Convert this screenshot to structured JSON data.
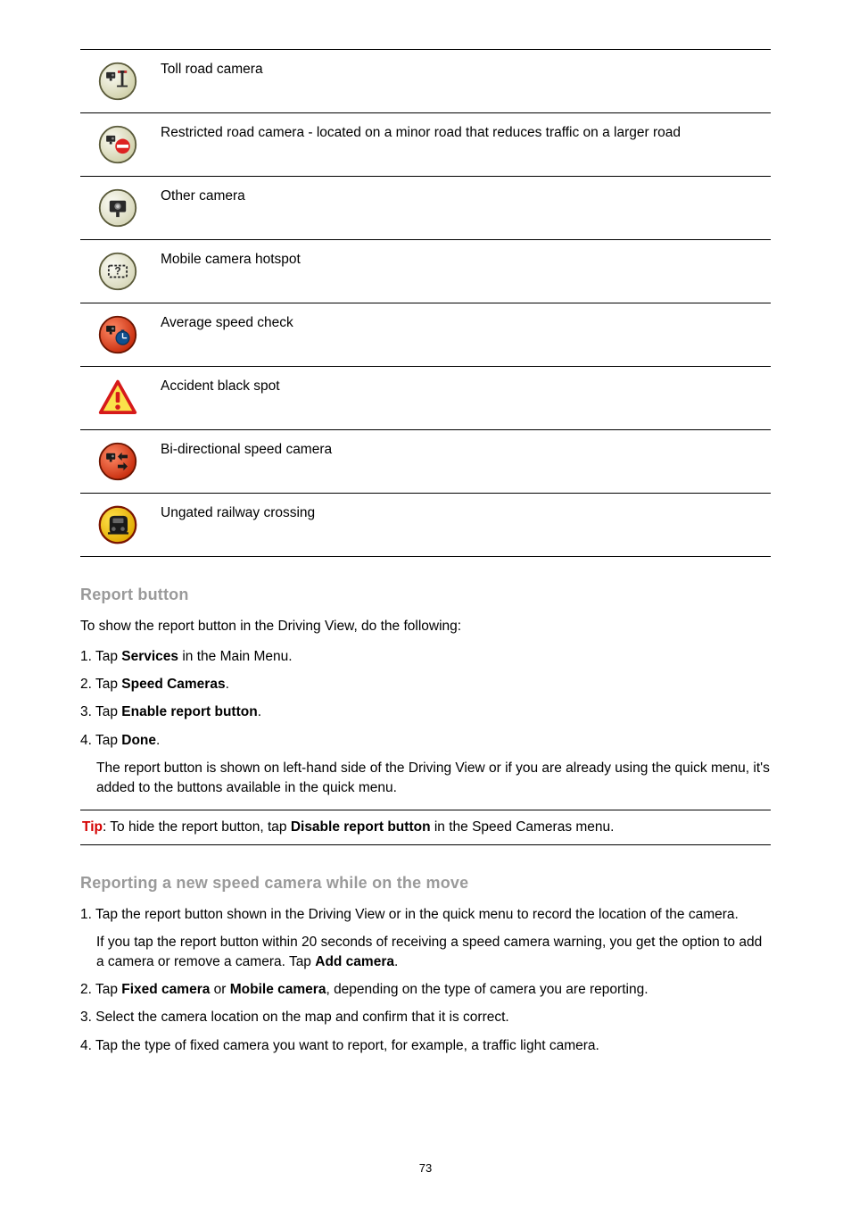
{
  "table_rows": [
    {
      "label": "Toll road camera"
    },
    {
      "label": "Restricted road camera - located on a minor road that reduces traffic on a larger road"
    },
    {
      "label": "Other camera"
    },
    {
      "label": "Mobile camera hotspot"
    },
    {
      "label": "Average speed check"
    },
    {
      "label": "Accident black spot"
    },
    {
      "label": "Bi-directional speed camera"
    },
    {
      "label": "Ungated railway crossing"
    }
  ],
  "section1": {
    "heading": "Report button",
    "intro": "To show the report button in the Driving View, do the following:",
    "steps": [
      {
        "prefix": "1. Tap ",
        "bold": "Services",
        "suffix": " in the Main Menu."
      },
      {
        "prefix": "2. Tap ",
        "bold": "Speed Cameras",
        "suffix": "."
      },
      {
        "prefix": "3. Tap ",
        "bold": "Enable report button",
        "suffix": "."
      },
      {
        "prefix": "4. Tap ",
        "bold": "Done",
        "suffix": "."
      }
    ],
    "after_steps": "The report button is shown on left-hand side of the Driving View or if you are already using the quick menu, it's added to the buttons available in the quick menu.",
    "tip": {
      "label": "Tip",
      "before_bold": ": To hide the report button, tap ",
      "bold": "Disable report button",
      "after_bold": " in the Speed Cameras menu."
    }
  },
  "section2": {
    "heading": "Reporting a new speed camera while on the move",
    "steps": [
      {
        "line": "1. Tap the report button shown in the Driving View or in the quick menu to record the location of the camera.",
        "sub_before": "If you tap the report button within 20 seconds of receiving a speed camera warning, you get the option to add a camera or remove a camera. Tap ",
        "sub_bold": "Add camera",
        "sub_after": "."
      },
      {
        "prefix": "2. Tap ",
        "bold1": "Fixed camera",
        "mid": " or ",
        "bold2": "Mobile camera",
        "suffix": ", depending on the type of camera you are reporting."
      },
      {
        "line": "3. Select the camera location on the map and confirm that it is correct."
      },
      {
        "line": "4. Tap the type of fixed camera you want to report, for example, a traffic light camera."
      }
    ]
  },
  "page_number": "73"
}
